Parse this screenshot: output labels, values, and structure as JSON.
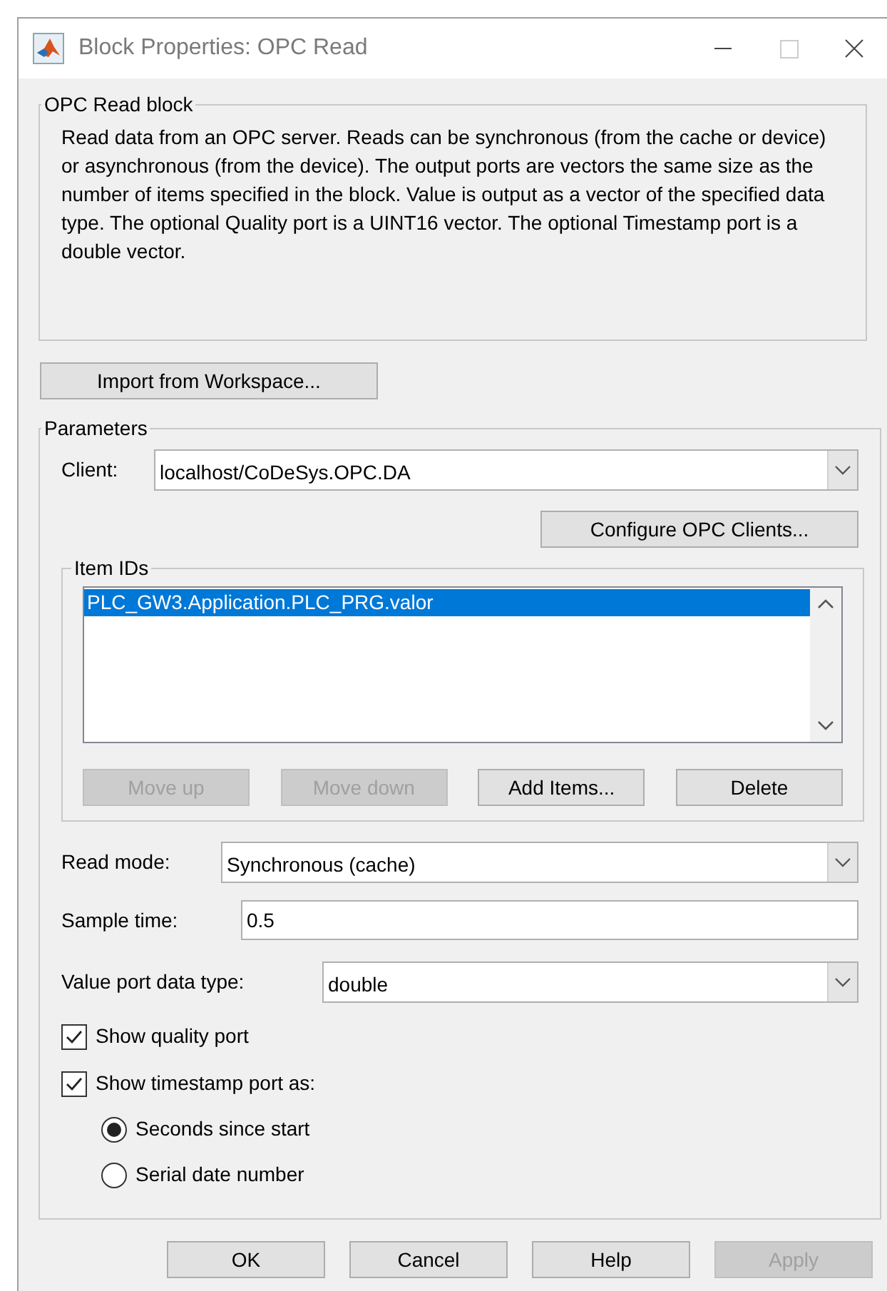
{
  "window": {
    "title": "Block Properties: OPC Read"
  },
  "description_group": {
    "title": "OPC Read block",
    "text": "Read data from an OPC server. Reads can be synchronous (from the cache or device) or asynchronous (from the device). The output ports are vectors the same size as the number of items specified in the block. Value is output as a vector of the specified data type. The optional Quality port is a UINT16 vector. The optional Timestamp port is a double vector."
  },
  "import_button": {
    "label": "Import from Workspace...",
    "disabled": false
  },
  "parameters": {
    "title": "Parameters",
    "client": {
      "label": "Client:",
      "value": "localhost/CoDeSys.OPC.DA"
    },
    "configure_button": {
      "label": "Configure OPC Clients...",
      "disabled": false
    },
    "item_ids": {
      "title": "Item IDs",
      "items": [
        {
          "label": "PLC_GW3.Application.PLC_PRG.valor",
          "selected": true
        }
      ],
      "buttons": [
        {
          "label": "Move up",
          "disabled": true
        },
        {
          "label": "Move down",
          "disabled": true
        },
        {
          "label": "Add Items...",
          "disabled": false
        },
        {
          "label": "Delete",
          "disabled": false
        }
      ]
    },
    "read_mode": {
      "label": "Read mode:",
      "value": "Synchronous (cache)"
    },
    "sample_time": {
      "label": "Sample time:",
      "value": "0.5"
    },
    "value_port_type": {
      "label": "Value port data type:",
      "value": "double"
    },
    "checkboxes": [
      {
        "label": "Show quality port",
        "checked": true
      },
      {
        "label": "Show timestamp port as:",
        "checked": true
      }
    ],
    "radios": [
      {
        "label": "Seconds since start",
        "selected": true
      },
      {
        "label": "Serial date number",
        "selected": false
      }
    ]
  },
  "buttons": [
    {
      "label": "OK",
      "disabled": false
    },
    {
      "label": "Cancel",
      "disabled": false
    },
    {
      "label": "Help",
      "disabled": false
    },
    {
      "label": "Apply",
      "disabled": true
    }
  ]
}
